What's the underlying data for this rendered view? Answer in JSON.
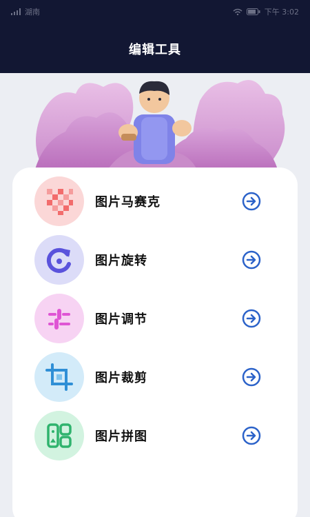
{
  "status_bar": {
    "left_text": "湖南",
    "right_text": "下午 3:02"
  },
  "header": {
    "title": "编辑工具"
  },
  "tools": [
    {
      "label": "图片马赛克",
      "icon": "mosaic-icon",
      "color": "#f26c6c"
    },
    {
      "label": "图片旋转",
      "icon": "rotate-icon",
      "color": "#6a60e8"
    },
    {
      "label": "图片调节",
      "icon": "adjust-icon",
      "color": "#df55d4"
    },
    {
      "label": "图片裁剪",
      "icon": "crop-icon",
      "color": "#3aa0e4"
    },
    {
      "label": "图片拼图",
      "icon": "collage-icon",
      "color": "#3ec883"
    }
  ],
  "colors": {
    "header_bg": "#121733",
    "accent_arrow": "#2b62c9",
    "page_bg": "#eceef3"
  }
}
